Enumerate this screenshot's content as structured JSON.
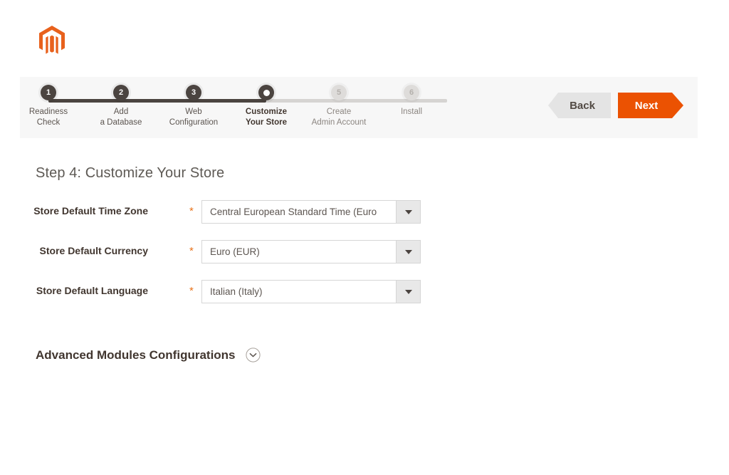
{
  "brand": {
    "logo_icon": "magento-logo-icon",
    "accent_color": "#eb5202"
  },
  "stepper": {
    "steps": [
      {
        "number": "1",
        "line1": "Readiness",
        "line2": "Check",
        "state": "done"
      },
      {
        "number": "2",
        "line1": "Add",
        "line2": "a Database",
        "state": "done"
      },
      {
        "number": "3",
        "line1": "Web",
        "line2": "Configuration",
        "state": "done"
      },
      {
        "number": "4",
        "line1": "Customize",
        "line2": "Your Store",
        "state": "active"
      },
      {
        "number": "5",
        "line1": "Create",
        "line2": "Admin Account",
        "state": "todo"
      },
      {
        "number": "6",
        "line1": "Install",
        "line2": "",
        "state": "todo"
      }
    ]
  },
  "nav": {
    "back_label": "Back",
    "next_label": "Next"
  },
  "main": {
    "page_title": "Step 4: Customize Your Store",
    "fields": [
      {
        "label": "Store Default Time Zone",
        "required_mark": "*",
        "value": "Central European Standard Time (Euro",
        "arrow_icon": "chevron-down-icon"
      },
      {
        "label": "Store Default Currency",
        "required_mark": "*",
        "value": "Euro (EUR)",
        "arrow_icon": "chevron-down-icon"
      },
      {
        "label": "Store Default Language",
        "required_mark": "*",
        "value": "Italian (Italy)",
        "arrow_icon": "chevron-down-icon"
      }
    ],
    "advanced": {
      "title": "Advanced Modules Configurations",
      "toggle_icon": "circled-chevron-down-icon"
    }
  }
}
